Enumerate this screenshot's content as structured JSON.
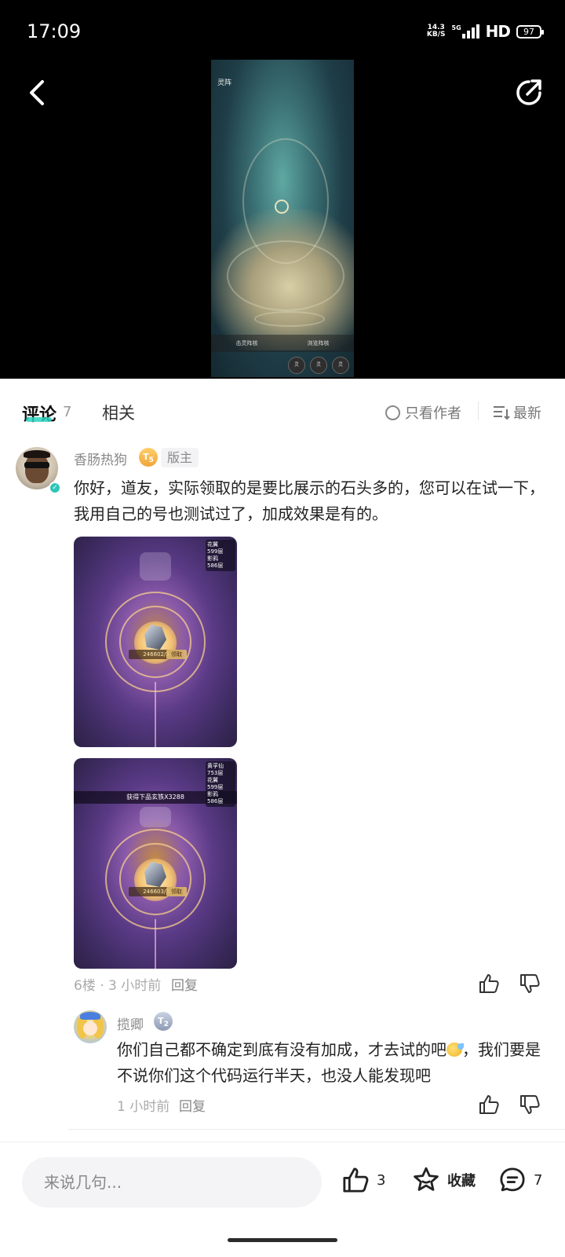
{
  "status": {
    "time": "17:09",
    "net_speed_value": "14.3",
    "net_speed_unit": "KB/S",
    "network": "5G",
    "hd": "HD",
    "battery": "97"
  },
  "video": {
    "title": "灵阵",
    "bottom_left": "击灵阵核",
    "bottom_right": "浏览阵核",
    "btn1": "灵",
    "btn2": "灵",
    "btn3": "灵"
  },
  "tabs": {
    "comments_label": "评论",
    "comments_count": "7",
    "related_label": "相关",
    "only_author": "只看作者",
    "sort": "最新"
  },
  "comment": {
    "author": "香肠热狗",
    "level": "5",
    "badge": "版主",
    "text": "你好，道友，实际领取的是要比展示的石头多的，您可以在试一下，我用自己的号也测试过了，加成效果是有的。",
    "images": [
      {
        "side_lines": [
          "花翼",
          "599层",
          "影鸦",
          "586层"
        ],
        "plate": "246602/3",
        "claim": "领取"
      },
      {
        "banner": "获得下品玄铁X3288",
        "side_lines": [
          "黄孚仙",
          "753层",
          "花翼",
          "599层",
          "影鸦",
          "586层"
        ],
        "plate": "246603/3",
        "claim": "领取"
      }
    ],
    "meta": "6楼 · 3 小时前",
    "reply_label": "回复"
  },
  "reply": {
    "author": "揽卿",
    "level": "2",
    "text_before": "你们自己都不确定到底有没有加成，才去试的吧",
    "text_after": "，我们要是不说你们这个代码运行半天，也没人能发现吧",
    "meta": "1 小时前",
    "reply_label": "回复"
  },
  "bottom": {
    "input_placeholder": "来说几句...",
    "like_count": "3",
    "favorite_label": "收藏",
    "comment_count": "7"
  },
  "colors": {
    "accent": "#2dd3c0",
    "background": "#ffffff",
    "top_background": "#000000"
  },
  "icons": [
    "back-icon",
    "share-icon",
    "like-icon",
    "dislike-icon",
    "star-icon",
    "comment-bubble-icon",
    "sort-icon",
    "radio-icon"
  ]
}
